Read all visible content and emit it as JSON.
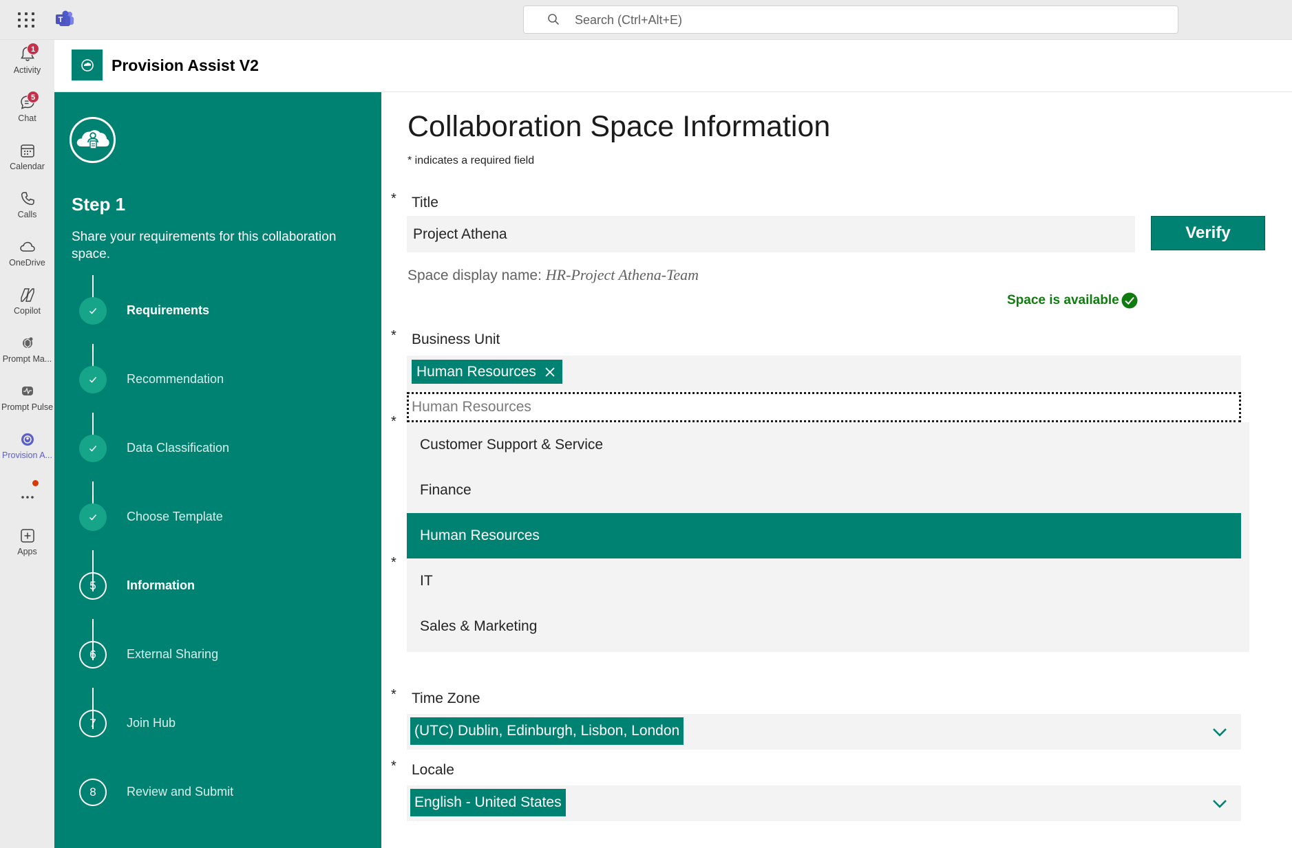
{
  "topbar": {
    "search_placeholder": "Search (Ctrl+Alt+E)"
  },
  "rail": {
    "items": [
      {
        "label": "Activity",
        "badge": "1",
        "icon": "bell-icon"
      },
      {
        "label": "Chat",
        "badge": "5",
        "icon": "chat-icon"
      },
      {
        "label": "Calendar",
        "icon": "calendar-icon"
      },
      {
        "label": "Calls",
        "icon": "phone-icon"
      },
      {
        "label": "OneDrive",
        "icon": "cloud-icon"
      },
      {
        "label": "Copilot",
        "icon": "copilot-icon"
      },
      {
        "label": "Prompt Ma...",
        "icon": "prompt-manager-icon"
      },
      {
        "label": "Prompt Pulse",
        "icon": "prompt-pulse-icon"
      },
      {
        "label": "Provision A...",
        "icon": "provision-assist-icon",
        "active": true
      },
      {
        "label": "Apps",
        "icon": "add-apps-icon"
      }
    ]
  },
  "app": {
    "title": "Provision Assist V2",
    "accent_color": "#008272"
  },
  "stepper": {
    "heading": "Step 1",
    "description": "Share your requirements for this collaboration space.",
    "steps": [
      {
        "label": "Requirements",
        "status": "done"
      },
      {
        "label": "Recommendation",
        "status": "done"
      },
      {
        "label": "Data Classification",
        "status": "done"
      },
      {
        "label": "Choose Template",
        "status": "done"
      },
      {
        "label": "Information",
        "number": "5",
        "status": "current"
      },
      {
        "label": "External Sharing",
        "number": "6",
        "status": "pending"
      },
      {
        "label": "Join Hub",
        "number": "7",
        "status": "pending"
      },
      {
        "label": "Review and Submit",
        "number": "8",
        "status": "pending"
      }
    ]
  },
  "form": {
    "page_title": "Collaboration Space Information",
    "required_note": "* indicates a required field",
    "required_marker": "*",
    "title_label": "Title",
    "title_value": "Project Athena",
    "verify_label": "Verify",
    "display_name_prefix": "Space display name:",
    "display_name_value": "HR-Project Athena-Team",
    "availability_text": "Space is available",
    "business_unit_label": "Business Unit",
    "business_unit_selected": "Human Resources",
    "business_unit_search_placeholder": "Human Resources",
    "business_unit_options": [
      "Customer Support & Service",
      "Finance",
      "Human Resources",
      "IT",
      "Sales & Marketing"
    ],
    "business_unit_highlighted": "Human Resources",
    "time_zone_label": "Time Zone",
    "time_zone_value": "(UTC) Dublin, Edinburgh, Lisbon, London",
    "locale_label": "Locale",
    "locale_value": "English - United States"
  }
}
